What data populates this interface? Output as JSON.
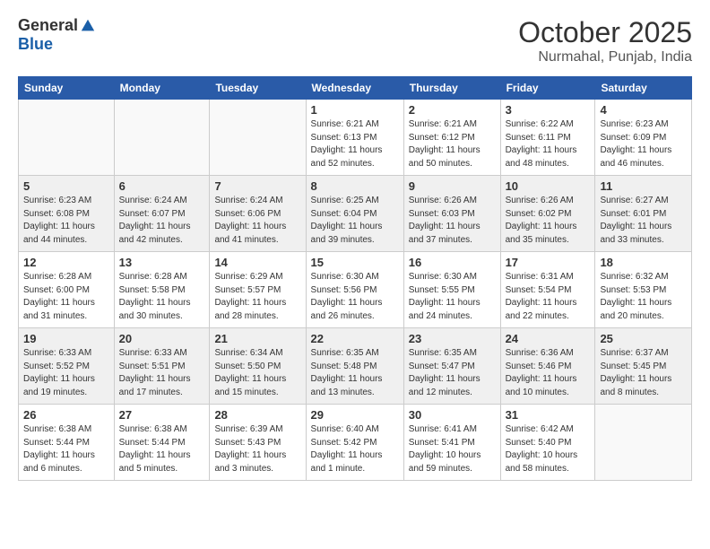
{
  "header": {
    "logo_general": "General",
    "logo_blue": "Blue",
    "month": "October 2025",
    "location": "Nurmahal, Punjab, India"
  },
  "days_of_week": [
    "Sunday",
    "Monday",
    "Tuesday",
    "Wednesday",
    "Thursday",
    "Friday",
    "Saturday"
  ],
  "weeks": [
    [
      {
        "day": "",
        "info": ""
      },
      {
        "day": "",
        "info": ""
      },
      {
        "day": "",
        "info": ""
      },
      {
        "day": "1",
        "info": "Sunrise: 6:21 AM\nSunset: 6:13 PM\nDaylight: 11 hours\nand 52 minutes."
      },
      {
        "day": "2",
        "info": "Sunrise: 6:21 AM\nSunset: 6:12 PM\nDaylight: 11 hours\nand 50 minutes."
      },
      {
        "day": "3",
        "info": "Sunrise: 6:22 AM\nSunset: 6:11 PM\nDaylight: 11 hours\nand 48 minutes."
      },
      {
        "day": "4",
        "info": "Sunrise: 6:23 AM\nSunset: 6:09 PM\nDaylight: 11 hours\nand 46 minutes."
      }
    ],
    [
      {
        "day": "5",
        "info": "Sunrise: 6:23 AM\nSunset: 6:08 PM\nDaylight: 11 hours\nand 44 minutes."
      },
      {
        "day": "6",
        "info": "Sunrise: 6:24 AM\nSunset: 6:07 PM\nDaylight: 11 hours\nand 42 minutes."
      },
      {
        "day": "7",
        "info": "Sunrise: 6:24 AM\nSunset: 6:06 PM\nDaylight: 11 hours\nand 41 minutes."
      },
      {
        "day": "8",
        "info": "Sunrise: 6:25 AM\nSunset: 6:04 PM\nDaylight: 11 hours\nand 39 minutes."
      },
      {
        "day": "9",
        "info": "Sunrise: 6:26 AM\nSunset: 6:03 PM\nDaylight: 11 hours\nand 37 minutes."
      },
      {
        "day": "10",
        "info": "Sunrise: 6:26 AM\nSunset: 6:02 PM\nDaylight: 11 hours\nand 35 minutes."
      },
      {
        "day": "11",
        "info": "Sunrise: 6:27 AM\nSunset: 6:01 PM\nDaylight: 11 hours\nand 33 minutes."
      }
    ],
    [
      {
        "day": "12",
        "info": "Sunrise: 6:28 AM\nSunset: 6:00 PM\nDaylight: 11 hours\nand 31 minutes."
      },
      {
        "day": "13",
        "info": "Sunrise: 6:28 AM\nSunset: 5:58 PM\nDaylight: 11 hours\nand 30 minutes."
      },
      {
        "day": "14",
        "info": "Sunrise: 6:29 AM\nSunset: 5:57 PM\nDaylight: 11 hours\nand 28 minutes."
      },
      {
        "day": "15",
        "info": "Sunrise: 6:30 AM\nSunset: 5:56 PM\nDaylight: 11 hours\nand 26 minutes."
      },
      {
        "day": "16",
        "info": "Sunrise: 6:30 AM\nSunset: 5:55 PM\nDaylight: 11 hours\nand 24 minutes."
      },
      {
        "day": "17",
        "info": "Sunrise: 6:31 AM\nSunset: 5:54 PM\nDaylight: 11 hours\nand 22 minutes."
      },
      {
        "day": "18",
        "info": "Sunrise: 6:32 AM\nSunset: 5:53 PM\nDaylight: 11 hours\nand 20 minutes."
      }
    ],
    [
      {
        "day": "19",
        "info": "Sunrise: 6:33 AM\nSunset: 5:52 PM\nDaylight: 11 hours\nand 19 minutes."
      },
      {
        "day": "20",
        "info": "Sunrise: 6:33 AM\nSunset: 5:51 PM\nDaylight: 11 hours\nand 17 minutes."
      },
      {
        "day": "21",
        "info": "Sunrise: 6:34 AM\nSunset: 5:50 PM\nDaylight: 11 hours\nand 15 minutes."
      },
      {
        "day": "22",
        "info": "Sunrise: 6:35 AM\nSunset: 5:48 PM\nDaylight: 11 hours\nand 13 minutes."
      },
      {
        "day": "23",
        "info": "Sunrise: 6:35 AM\nSunset: 5:47 PM\nDaylight: 11 hours\nand 12 minutes."
      },
      {
        "day": "24",
        "info": "Sunrise: 6:36 AM\nSunset: 5:46 PM\nDaylight: 11 hours\nand 10 minutes."
      },
      {
        "day": "25",
        "info": "Sunrise: 6:37 AM\nSunset: 5:45 PM\nDaylight: 11 hours\nand 8 minutes."
      }
    ],
    [
      {
        "day": "26",
        "info": "Sunrise: 6:38 AM\nSunset: 5:44 PM\nDaylight: 11 hours\nand 6 minutes."
      },
      {
        "day": "27",
        "info": "Sunrise: 6:38 AM\nSunset: 5:44 PM\nDaylight: 11 hours\nand 5 minutes."
      },
      {
        "day": "28",
        "info": "Sunrise: 6:39 AM\nSunset: 5:43 PM\nDaylight: 11 hours\nand 3 minutes."
      },
      {
        "day": "29",
        "info": "Sunrise: 6:40 AM\nSunset: 5:42 PM\nDaylight: 11 hours\nand 1 minute."
      },
      {
        "day": "30",
        "info": "Sunrise: 6:41 AM\nSunset: 5:41 PM\nDaylight: 10 hours\nand 59 minutes."
      },
      {
        "day": "31",
        "info": "Sunrise: 6:42 AM\nSunset: 5:40 PM\nDaylight: 10 hours\nand 58 minutes."
      },
      {
        "day": "",
        "info": ""
      }
    ]
  ]
}
